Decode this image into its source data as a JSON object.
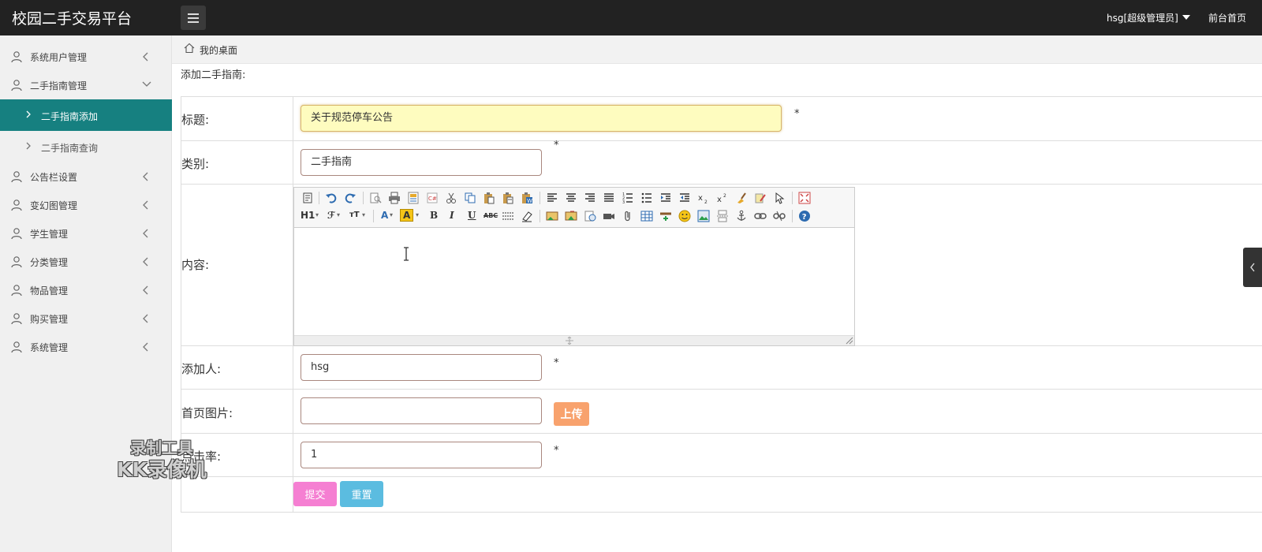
{
  "app": {
    "title": "校园二手交易平台"
  },
  "header": {
    "user": "hsg[超级管理员]",
    "home_link": "前台首页"
  },
  "sidebar": {
    "items": [
      {
        "label": "系统用户管理",
        "expanded": false
      },
      {
        "label": "二手指南管理",
        "expanded": true
      },
      {
        "label": "公告栏设置",
        "expanded": false
      },
      {
        "label": "变幻图管理",
        "expanded": false
      },
      {
        "label": "学生管理",
        "expanded": false
      },
      {
        "label": "分类管理",
        "expanded": false
      },
      {
        "label": "物品管理",
        "expanded": false
      },
      {
        "label": "购买管理",
        "expanded": false
      },
      {
        "label": "系统管理",
        "expanded": false
      }
    ],
    "subitems": [
      {
        "label": "二手指南添加",
        "active": true
      },
      {
        "label": "二手指南查询",
        "active": false
      }
    ]
  },
  "breadcrumb": {
    "text": "我的桌面"
  },
  "form": {
    "heading": "添加二手指南:",
    "title_label": "标题:",
    "title_value": "关于规范停车公告",
    "category_label": "类别:",
    "category_value": "二手指南",
    "content_label": "内容:",
    "adder_label": "添加人:",
    "adder_value": "hsg",
    "image_label": "首页图片:",
    "image_value": "",
    "upload_label": "上传",
    "clickrate_label": "点击率:",
    "clickrate_value": "1",
    "required_mark": "*",
    "submit_label": "提交",
    "reset_label": "重置"
  },
  "editor": {
    "heading_label": "H1",
    "font_label": "ℱ",
    "size_label": "тT",
    "forecolor_label": "A",
    "backcolor_label": "A",
    "bold_label": "B",
    "italic_label": "I",
    "underline_label": "U",
    "strike_label": "ABC"
  },
  "watermark": {
    "line1": "录制工具",
    "line2": "KK录像机"
  },
  "colors": {
    "topbar": "#222222",
    "sidebar_active": "#168080",
    "focus_field": "#fefcbf",
    "upload": "#f8a26d",
    "submit": "#f57fd2",
    "reset": "#5bbce0"
  }
}
